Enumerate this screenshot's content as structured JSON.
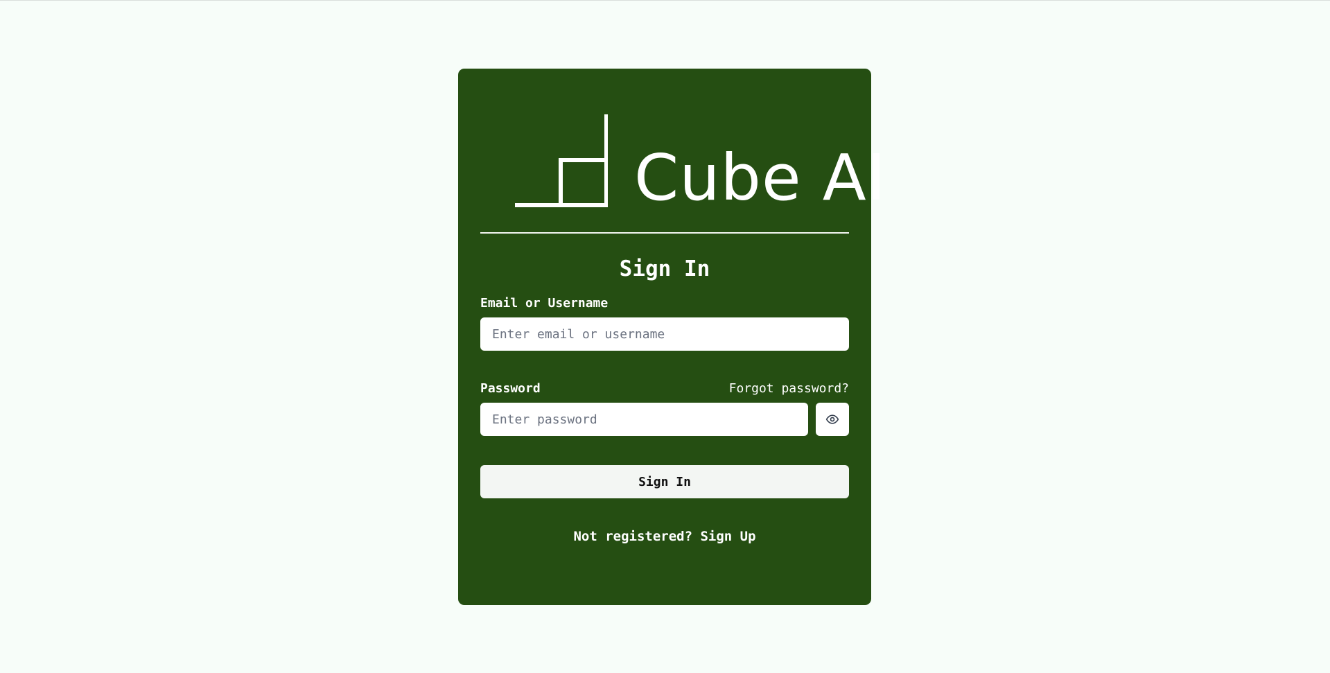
{
  "brand": {
    "name": "Cube AI",
    "logo_icon": "cube-ai-logo-icon"
  },
  "form": {
    "title": "Sign In",
    "email": {
      "label": "Email or Username",
      "value": "",
      "placeholder": "Enter email or username"
    },
    "password": {
      "label": "Password",
      "value": "",
      "placeholder": "Enter password",
      "forgot_link": "Forgot password?",
      "toggle_icon": "eye-icon"
    },
    "submit_label": "Sign In",
    "footer": {
      "prompt": "Not registered?",
      "link": "Sign Up"
    }
  },
  "colors": {
    "page_background": "#f7fdf9",
    "card_background": "#254e12",
    "button_background": "#f3f6f3"
  }
}
